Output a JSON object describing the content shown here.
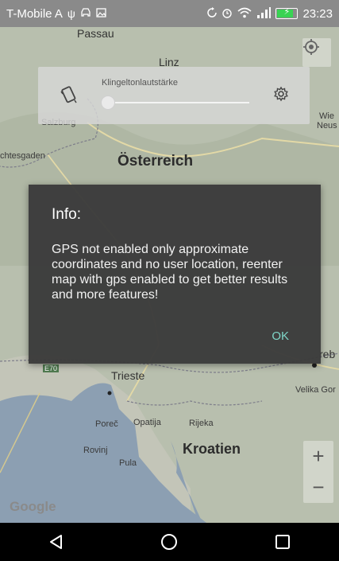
{
  "status_bar": {
    "carrier": "T-Mobile A",
    "time": "23:23",
    "battery_level": 0.85,
    "icons": [
      "usb-icon",
      "car-icon",
      "image-icon",
      "sync-icon",
      "alarm-icon",
      "wifi-icon",
      "signal-icon",
      "battery-icon"
    ]
  },
  "map": {
    "labels": {
      "passau": "Passau",
      "linz": "Linz",
      "salzburg": "Salzburg",
      "berchtesgaden": "chtesgaden",
      "oesterreich": "Österreich",
      "wie": "Wie",
      "neus": "Neus",
      "zagreb": "reb",
      "trieste": "Trieste",
      "velika_gorica": "Velika Gor",
      "porec": "Poreč",
      "opatija": "Opatija",
      "rijeka": "Rijeka",
      "rovinj": "Rovinj",
      "pula": "Pula",
      "kroatien": "Kroatien",
      "e70": "E70"
    },
    "attribution": "Google",
    "zoom_in": "+",
    "zoom_out": "−"
  },
  "volume_panel": {
    "label": "Klingeltonlautstärke",
    "level": 0
  },
  "dialog": {
    "title": "Info:",
    "message": "GPS not enabled only approximate coordinates and no user location, reenter map with gps enabled to get better results and more features!",
    "ok_label": "OK"
  },
  "colors": {
    "accent": "#7fd6c8",
    "dialog_bg": "#3a3a3a",
    "map_bg": "#b6bcae",
    "water": "#8c9fb2"
  }
}
